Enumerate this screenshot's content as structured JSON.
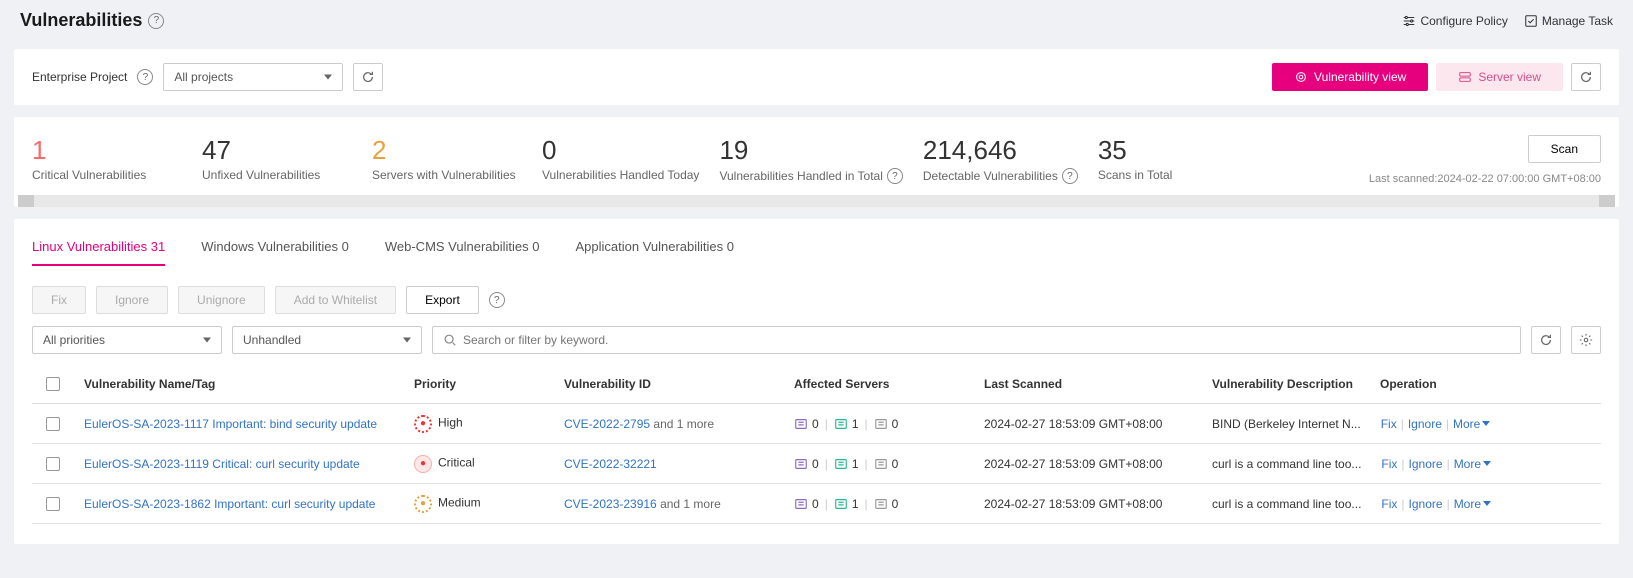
{
  "page": {
    "title": "Vulnerabilities",
    "configure_policy": "Configure Policy",
    "manage_task": "Manage Task"
  },
  "enterprise_project": {
    "label": "Enterprise Project",
    "selected": "All projects"
  },
  "view": {
    "vuln": "Vulnerability view",
    "server": "Server view"
  },
  "stats": {
    "critical": {
      "value": "1",
      "label": "Critical Vulnerabilities"
    },
    "unfixed": {
      "value": "47",
      "label": "Unfixed Vulnerabilities"
    },
    "servers": {
      "value": "2",
      "label": "Servers with Vulnerabilities"
    },
    "handled_today": {
      "value": "0",
      "label": "Vulnerabilities Handled Today"
    },
    "handled_total": {
      "value": "19",
      "label": "Vulnerabilities Handled in Total"
    },
    "detectable": {
      "value": "214,646",
      "label": "Detectable Vulnerabilities"
    },
    "scans": {
      "value": "35",
      "label": "Scans in Total"
    },
    "last_scanned": "Last scanned:2024-02-22 07:00:00 GMT+08:00",
    "scan_btn": "Scan"
  },
  "tabs": {
    "linux": "Linux Vulnerabilities 31",
    "windows": "Windows Vulnerabilities 0",
    "webcms": "Web-CMS Vulnerabilities 0",
    "app": "Application Vulnerabilities 0"
  },
  "actions": {
    "fix": "Fix",
    "ignore": "Ignore",
    "unignore": "Unignore",
    "whitelist": "Add to Whitelist",
    "export": "Export"
  },
  "filters": {
    "priority": "All priorities",
    "status": "Unhandled",
    "search_placeholder": "Search or filter by keyword."
  },
  "columns": {
    "name": "Vulnerability Name/Tag",
    "priority": "Priority",
    "id": "Vulnerability ID",
    "affected": "Affected Servers",
    "scanned": "Last Scanned",
    "desc": "Vulnerability Description",
    "op": "Operation"
  },
  "ops": {
    "fix": "Fix",
    "ignore": "Ignore",
    "more": "More"
  },
  "rows": [
    {
      "name": "EulerOS-SA-2023-1117 Important: bind security update",
      "priority": "High",
      "priority_level": "high",
      "vuln_id": "CVE-2022-2795",
      "vuln_id_more": " and 1 more",
      "aff0": "0",
      "aff1": "1",
      "aff2": "0",
      "scanned": "2024-02-27 18:53:09 GMT+08:00",
      "desc": "BIND (Berkeley Internet N..."
    },
    {
      "name": "EulerOS-SA-2023-1119 Critical: curl security update",
      "priority": "Critical",
      "priority_level": "critical",
      "vuln_id": "CVE-2022-32221",
      "vuln_id_more": "",
      "aff0": "0",
      "aff1": "1",
      "aff2": "0",
      "scanned": "2024-02-27 18:53:09 GMT+08:00",
      "desc": "curl is a command line too..."
    },
    {
      "name": "EulerOS-SA-2023-1862 Important: curl security update",
      "priority": "Medium",
      "priority_level": "medium",
      "vuln_id": "CVE-2023-23916",
      "vuln_id_more": " and 1 more",
      "aff0": "0",
      "aff1": "1",
      "aff2": "0",
      "scanned": "2024-02-27 18:53:09 GMT+08:00",
      "desc": "curl is a command line too..."
    }
  ]
}
